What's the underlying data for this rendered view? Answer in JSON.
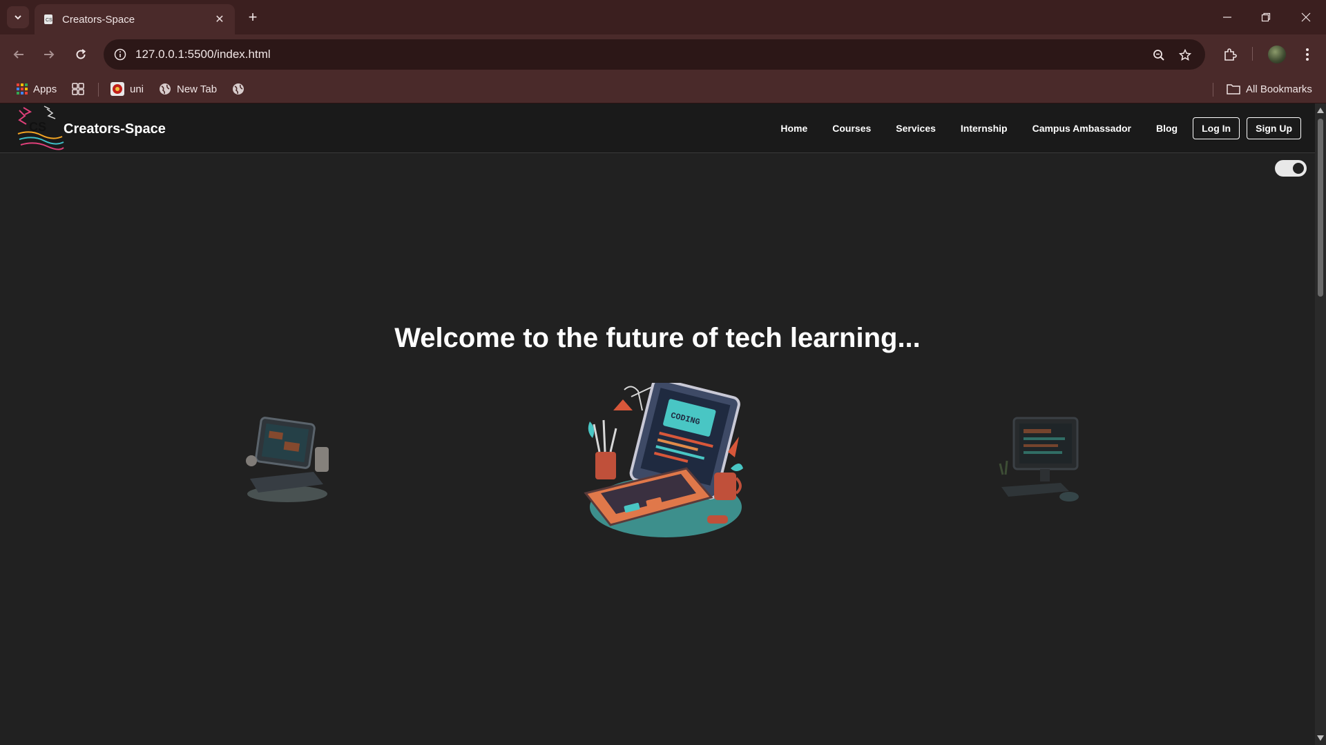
{
  "browser": {
    "tab_title": "Creators-Space",
    "url": "127.0.0.1:5500/index.html",
    "bookmarks": [
      {
        "label": "Apps",
        "icon": "apps-grid-icon"
      },
      {
        "label": "",
        "icon": "tab-groups-icon"
      },
      {
        "label": "uni",
        "icon": "uni-favicon-icon"
      },
      {
        "label": "New Tab",
        "icon": "globe-icon"
      },
      {
        "label": "",
        "icon": "globe-icon"
      }
    ],
    "all_bookmarks_label": "All Bookmarks"
  },
  "site": {
    "brand": "Creators-Space",
    "logo_text": "CS",
    "nav": [
      "Home",
      "Courses",
      "Services",
      "Internship",
      "Campus Ambassador",
      "Blog"
    ],
    "login_label": "Log In",
    "signup_label": "Sign Up",
    "dark_mode_toggle": "on"
  },
  "hero": {
    "title": "Welcome to the future of tech learning...",
    "screen_text": "CODING"
  },
  "colors": {
    "tab_bar": "#3b1f1f",
    "toolbar": "#4a2a2a",
    "page_bg": "#212121",
    "nav_bg": "#1a1a1a"
  }
}
